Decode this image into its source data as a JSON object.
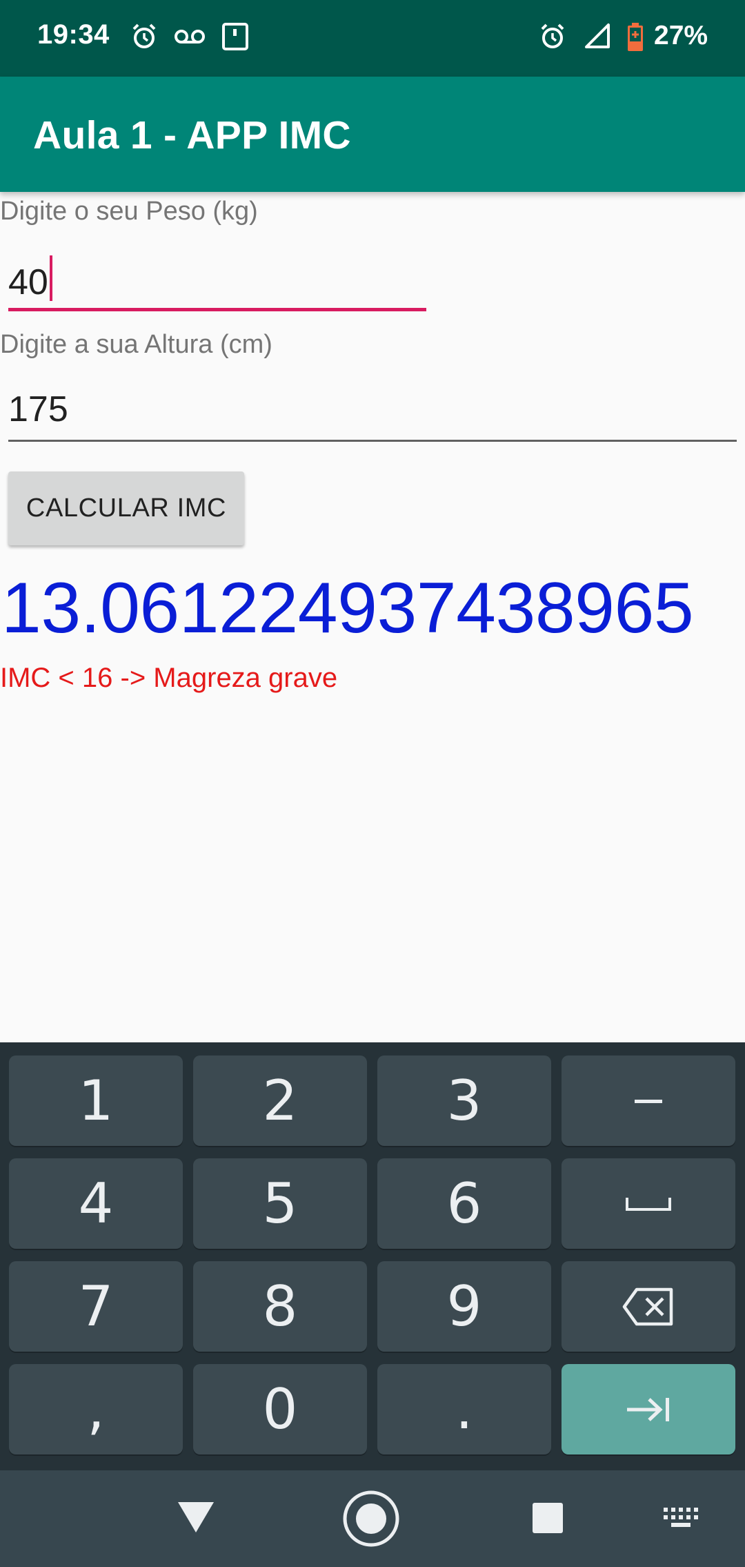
{
  "status_bar": {
    "time": "19:34",
    "battery": "27%"
  },
  "app_bar": {
    "title": "Aula 1 - APP IMC"
  },
  "form": {
    "weight_label": "Digite o seu Peso (kg)",
    "weight_value": "40",
    "height_label": "Digite a sua Altura (cm)",
    "height_value": "175",
    "calc_button": "CALCULAR IMC"
  },
  "result": {
    "value": "13.061224937438965",
    "classification": "IMC < 16 -> Magreza grave"
  },
  "keyboard": {
    "keys": [
      "1",
      "2",
      "3",
      "-",
      "4",
      "5",
      "6",
      "␣",
      "7",
      "8",
      "9",
      "⌫",
      ",",
      "0",
      ".",
      "⇥"
    ]
  },
  "colors": {
    "status_bar": "#00574b",
    "app_bar": "#008577",
    "accent": "#d81b60",
    "result_text": "#0a1ed6",
    "classification_text": "#e51a1a"
  }
}
